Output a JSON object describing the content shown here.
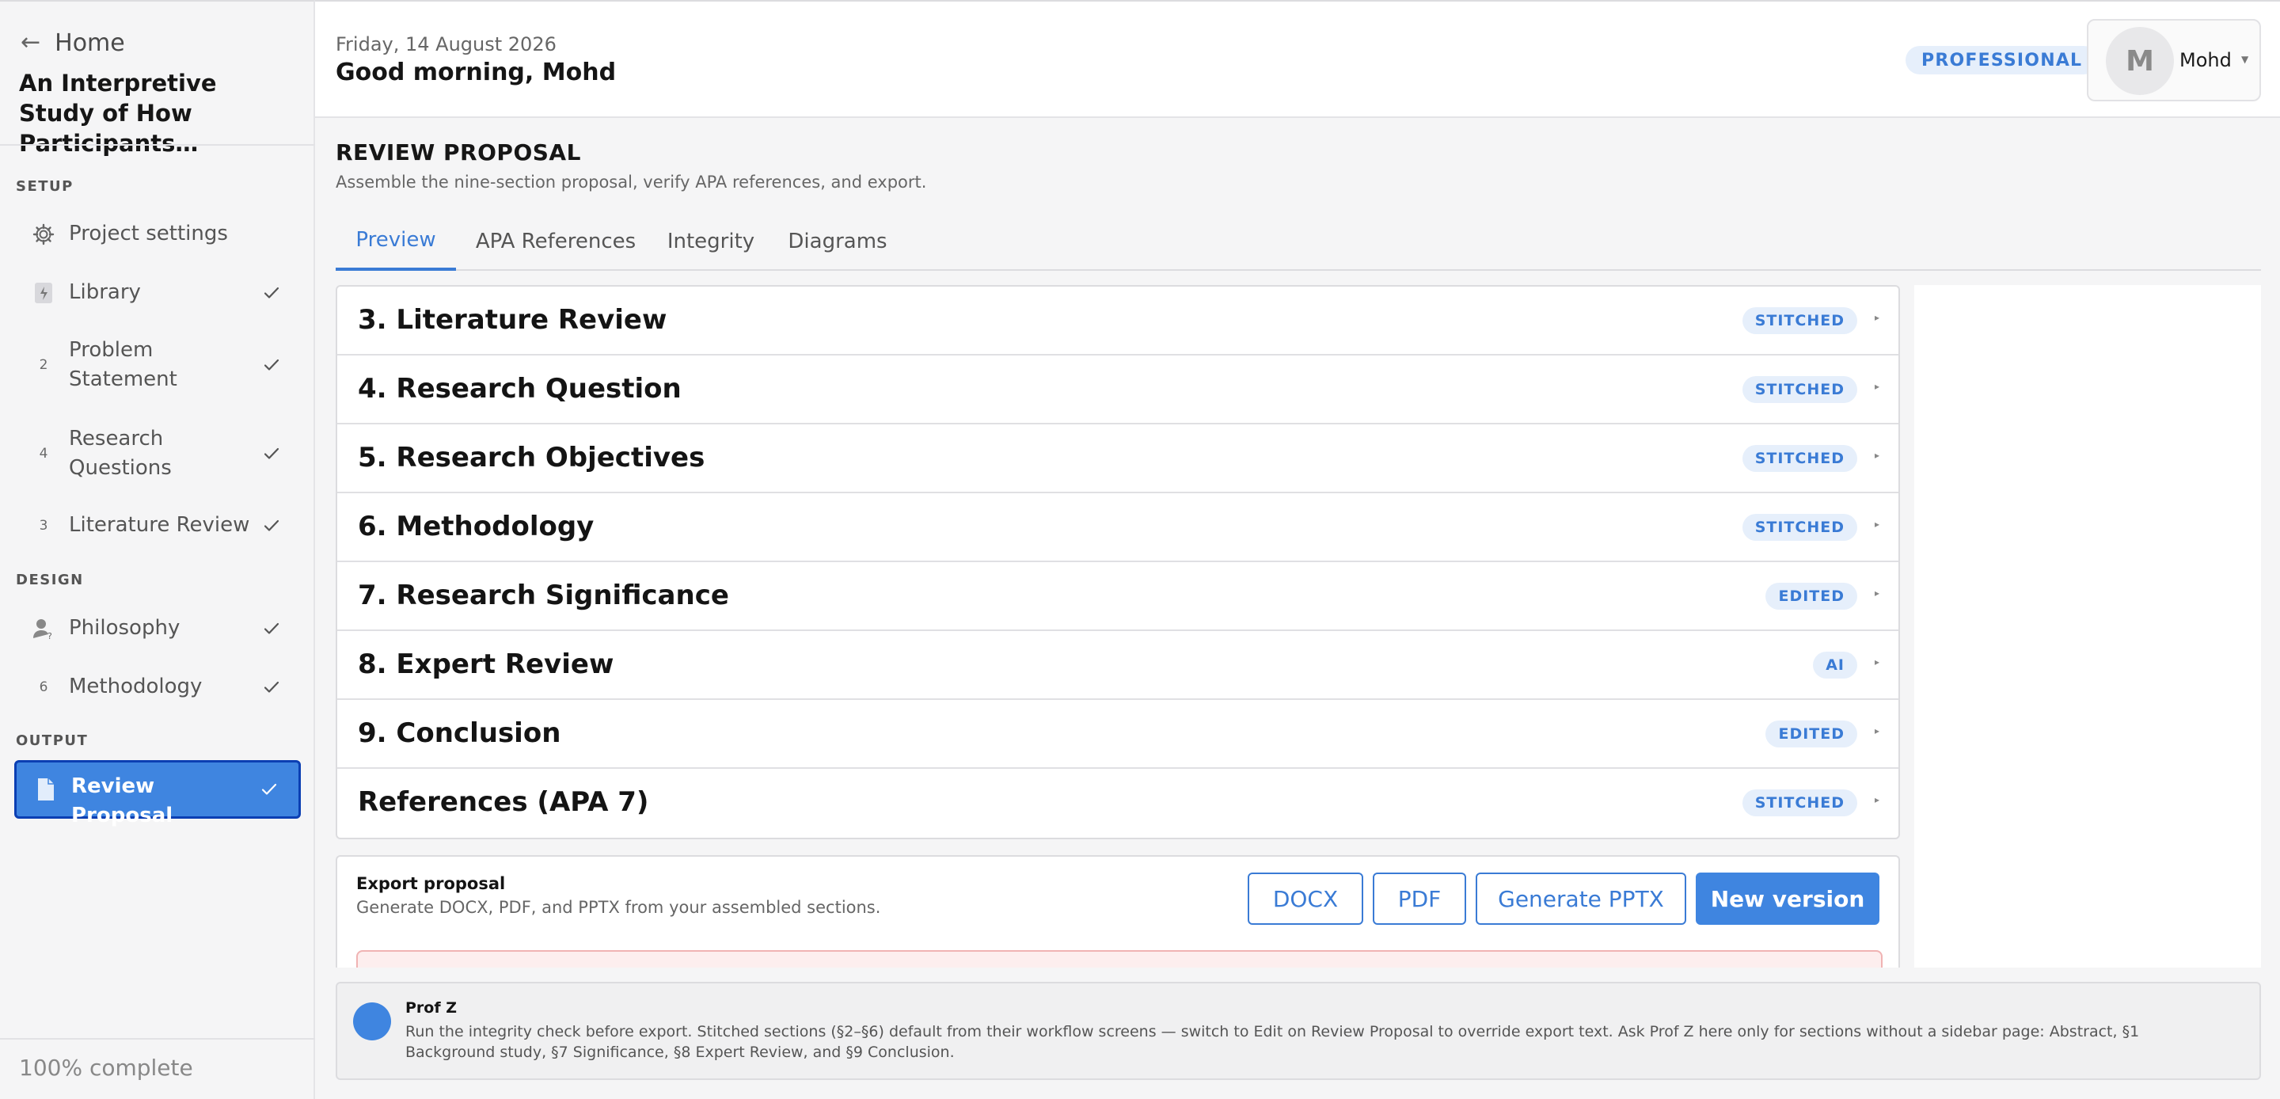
{
  "sidebar": {
    "home_label": "Home",
    "project_title": "An Interpretive Study of How Participants…",
    "sections": [
      {
        "heading": "SETUP"
      },
      {
        "heading": "DESIGN"
      },
      {
        "heading": "OUTPUT"
      }
    ],
    "items": [
      {
        "label": "Project settings",
        "icon": "gear-icon",
        "glyph": "⚙",
        "done": false
      },
      {
        "label": "Library",
        "icon": "library-icon",
        "glyph": "▤",
        "done": true
      },
      {
        "label": "Problem Statement",
        "icon": "step-2-icon",
        "glyph": "2",
        "done": true
      },
      {
        "label": "Research Questions",
        "icon": "step-4-icon",
        "glyph": "4",
        "done": true
      },
      {
        "label": "Literature Review",
        "icon": "step-3-icon",
        "glyph": "3",
        "done": true
      },
      {
        "label": "Philosophy",
        "icon": "person-question-icon",
        "glyph": "",
        "done": true
      },
      {
        "label": "Methodology",
        "icon": "step-6-icon",
        "glyph": "6",
        "done": true
      },
      {
        "label": "Review Proposal",
        "icon": "document-icon",
        "glyph": "",
        "done": true,
        "active": true
      }
    ],
    "progress_text": "100% complete"
  },
  "header": {
    "date": "Friday, 14 August 2026",
    "greeting": "Good morning, Mohd",
    "plan_badge": "PROFESSIONAL",
    "user_initial": "M",
    "user_name": "Mohd"
  },
  "main": {
    "title": "REVIEW PROPOSAL",
    "subtitle": "Assemble the nine-section proposal, verify APA references, and export.",
    "tabs": [
      {
        "label": "Preview",
        "active": true
      },
      {
        "label": "APA References",
        "active": false
      },
      {
        "label": "Integrity",
        "active": false
      },
      {
        "label": "Diagrams",
        "active": false
      }
    ],
    "sections": [
      {
        "title": "3. Literature Review",
        "status": "STITCHED"
      },
      {
        "title": "4. Research Question",
        "status": "STITCHED"
      },
      {
        "title": "5. Research Objectives",
        "status": "STITCHED"
      },
      {
        "title": "6. Methodology",
        "status": "STITCHED"
      },
      {
        "title": "7. Research Significance",
        "status": "EDITED"
      },
      {
        "title": "8. Expert Review",
        "status": "AI"
      },
      {
        "title": "9. Conclusion",
        "status": "EDITED"
      },
      {
        "title": "References (APA 7)",
        "status": "STITCHED"
      }
    ],
    "export": {
      "title": "Export proposal",
      "subtitle": "Generate DOCX, PDF, and PPTX from your assembled sections.",
      "buttons": {
        "docx": "DOCX",
        "pdf": "PDF",
        "pptx": "Generate PPTX",
        "new_version": "New version"
      }
    }
  },
  "assistant": {
    "name": "Prof Z",
    "message": "Run the integrity check before export. Stitched sections (§2–§6) default from their workflow screens — switch to Edit on Review Proposal to override export text. Ask Prof Z here only for sections without a sidebar page: Abstract, §1 Background study, §7 Significance, §8 Expert Review, and §9 Conclusion."
  },
  "colors": {
    "accent": "#3f85e0",
    "accent_text": "#3a7bd5",
    "badge_bg": "#e6effb",
    "active_border": "#0b3fb3",
    "alert_bg": "#fdeeee"
  }
}
